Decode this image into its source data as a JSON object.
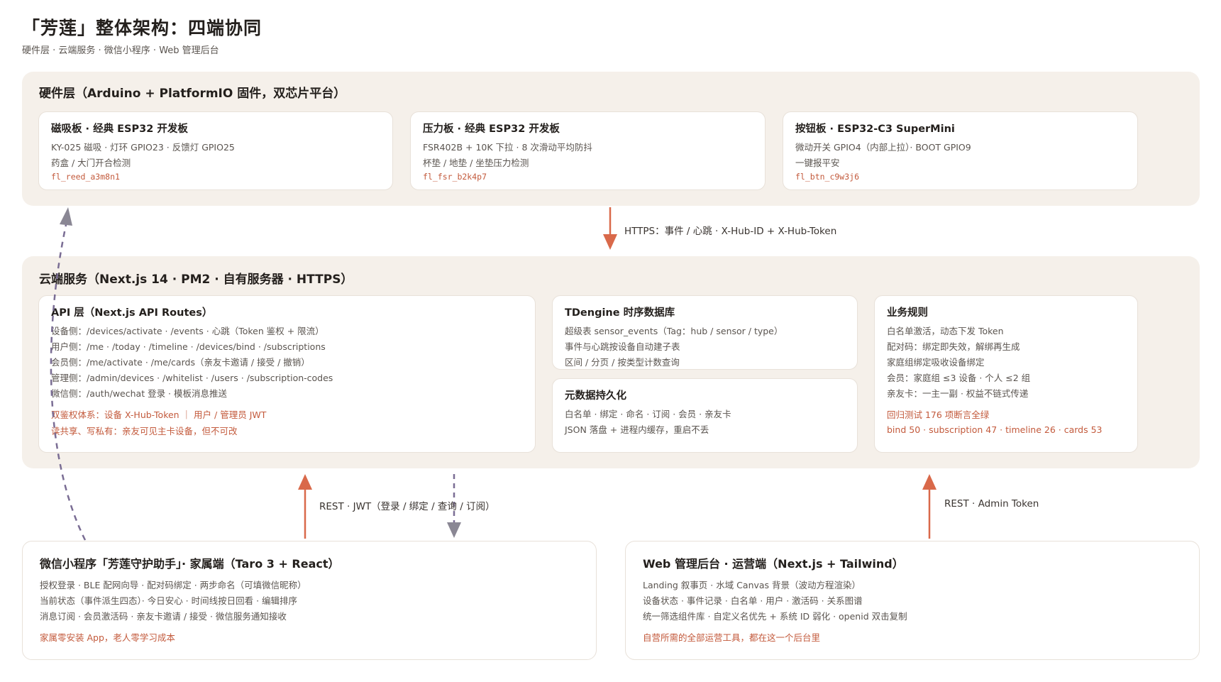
{
  "header": {
    "title": "「芳莲」整体架构：四端协同",
    "subtitle": "硬件层 · 云端服务 · 微信小程序 · Web 管理后台"
  },
  "hardware": {
    "title": "硬件层（Arduino + PlatformIO 固件，双芯片平台）",
    "cards": [
      {
        "title": "磁吸板 · 经典 ESP32 开发板",
        "lines": [
          "KY-025 磁吸 · 灯环 GPIO23 · 反馈灯 GPIO25",
          "药盒 / 大门开合检测"
        ],
        "code": "fl_reed_a3m8n1"
      },
      {
        "title": "压力板 · 经典 ESP32 开发板",
        "lines": [
          "FSR402B + 10K 下拉 · 8 次滑动平均防抖",
          "杯垫 / 地垫 / 坐垫压力检测"
        ],
        "code": "fl_fsr_b2k4p7"
      },
      {
        "title": "按钮板 · ESP32-C3 SuperMini",
        "lines": [
          "微动开关 GPIO4（内部上拉）· BOOT GPIO9",
          "一键报平安"
        ],
        "code": "fl_btn_c9w3j6"
      }
    ]
  },
  "arrows": {
    "hw_to_cloud": "HTTPS：事件 / 心跳 · X-Hub-ID + X-Hub-Token",
    "mini_to_cloud": "REST · JWT（登录 / 绑定 / 查询 / 订阅）",
    "web_to_cloud": "REST · Admin Token"
  },
  "cloud": {
    "title": "云端服务（Next.js 14 · PM2 · 自有服务器 · HTTPS）",
    "api": {
      "title": "API 层（Next.js API Routes）",
      "lines": [
        "设备侧：/devices/activate · /events · 心跳（Token 鉴权 + 限流）",
        "用户侧：/me · /today · /timeline · /devices/bind · /subscriptions",
        "会员侧：/me/activate · /me/cards（亲友卡邀请 / 接受 / 撤销）",
        "管理侧：/admin/devices · /whitelist · /users · /subscription-codes",
        "微信侧：/auth/wechat 登录 · 模板消息推送"
      ],
      "notes": [
        "双鉴权体系：设备 X-Hub-Token ｜ 用户 / 管理员 JWT",
        "读共享、写私有：亲友可见主卡设备，但不可改"
      ]
    },
    "tdengine": {
      "title": "TDengine 时序数据库",
      "lines": [
        "超级表 sensor_events（Tag：hub / sensor / type）",
        "事件与心跳按设备自动建子表",
        "区间 / 分页 / 按类型计数查询"
      ]
    },
    "metadata": {
      "title": "元数据持久化",
      "lines": [
        "白名单 · 绑定 · 命名 · 订阅 · 会员 · 亲友卡",
        "JSON 落盘 + 进程内缓存，重启不丢"
      ]
    },
    "rules": {
      "title": "业务规则",
      "lines": [
        "白名单激活，动态下发 Token",
        "配对码：绑定即失效，解绑再生成",
        "家庭组绑定吸收设备绑定",
        "会员：家庭组 ≤3 设备 · 个人 ≤2 组",
        "亲友卡：一主一副 · 权益不链式传递"
      ],
      "notes": [
        "回归测试 176 项断言全绿",
        "bind 50 · subscription 47 · timeline 26 · cards 53"
      ]
    }
  },
  "miniprogram": {
    "title": "微信小程序「芳莲守护助手」· 家属端（Taro 3 + React）",
    "lines": [
      "授权登录 · BLE 配网向导 · 配对码绑定 · 两步命名（可填微信昵称）",
      "当前状态（事件派生四态）· 今日安心 · 时间线按日回看 · 编辑排序",
      "消息订阅 · 会员激活码 · 亲友卡邀请 / 接受 · 微信服务通知接收"
    ],
    "note": "家属零安装 App，老人零学习成本"
  },
  "webadmin": {
    "title": "Web 管理后台 · 运营端（Next.js + Tailwind）",
    "lines": [
      "Landing 叙事页 · 水域 Canvas 背景（波动方程渲染）",
      "设备状态 · 事件记录 · 白名单 · 用户 · 激活码 · 关系图谱",
      "统一筛选组件库 · 自定义名优先 + 系统 ID 弱化 · openid 双击复制"
    ],
    "note": "自营所需的全部运营工具，都在这一个后台里"
  },
  "colors": {
    "accent": "#d9694a",
    "dashed": "#7a6d94",
    "layer_bg": "#f5f0ea"
  }
}
